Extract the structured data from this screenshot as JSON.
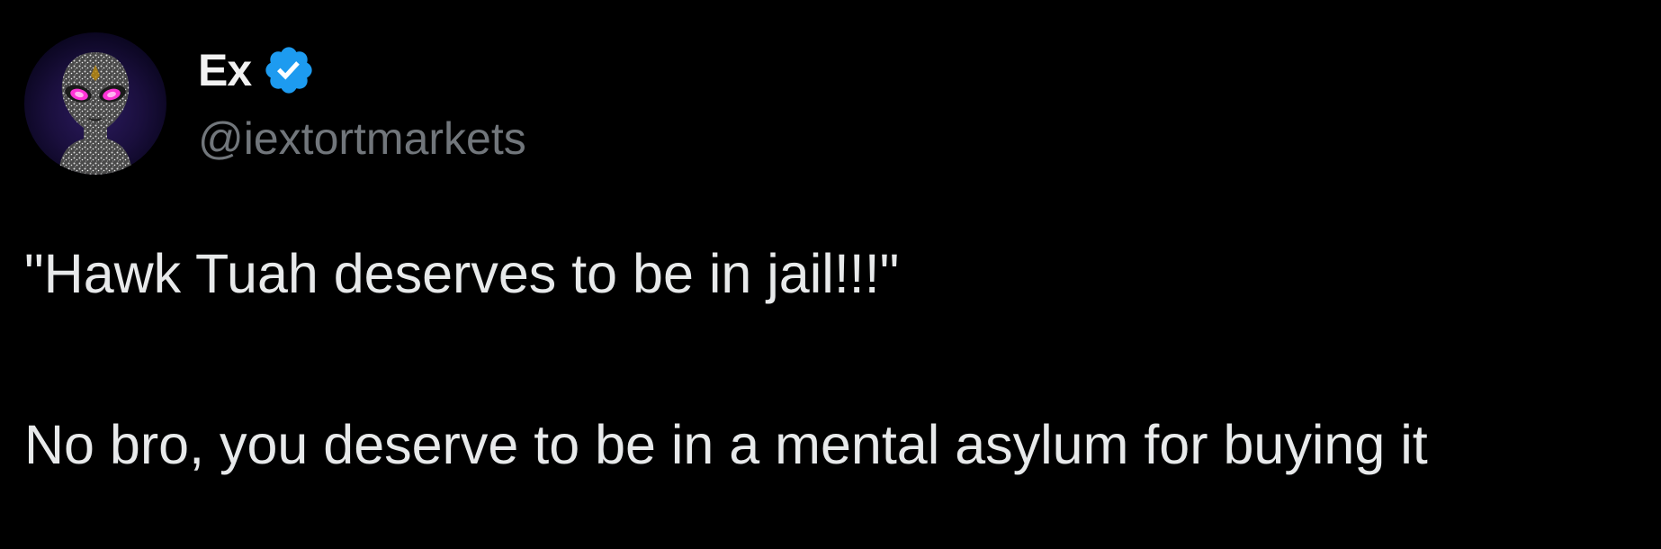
{
  "author": {
    "display_name": "Ex",
    "handle": "@iextortmarkets",
    "verified": true,
    "avatar_icon": "alien-portrait-avatar",
    "verified_icon": "verified-badge-icon"
  },
  "tweet": {
    "lines": [
      "\"Hawk Tuah deserves to be in jail!!!\"",
      "No bro, you deserve to be in a mental asylum for buying it"
    ]
  },
  "colors": {
    "background": "#000000",
    "text": "#e7e9ea",
    "secondary_text": "#71767b",
    "verified_blue": "#1d9bf0",
    "avatar_eyes": "#ff33d6"
  }
}
